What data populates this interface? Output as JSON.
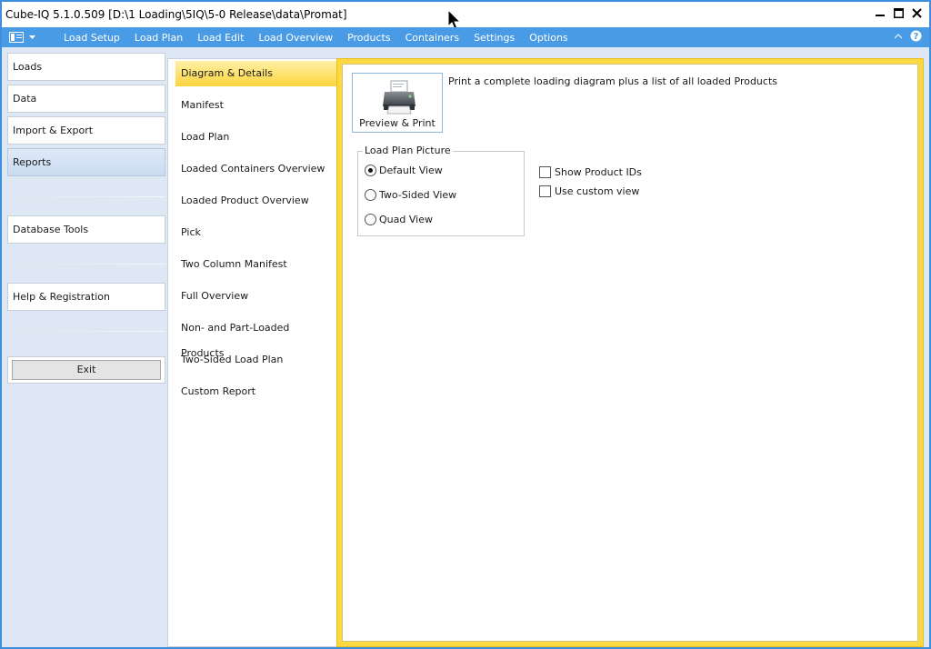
{
  "window": {
    "title": "Cube-IQ  5.1.0.509  [D:\\1 Loading\\5IQ\\5-0  Release\\data\\Promat]"
  },
  "menubar": {
    "items": [
      "Load Setup",
      "Load Plan",
      "Load Edit",
      "Load Overview",
      "Products",
      "Containers",
      "Settings",
      "Options"
    ]
  },
  "leftnav": {
    "loads": "Loads",
    "data": "Data",
    "import_export": "Import & Export",
    "reports": "Reports",
    "database_tools": "Database Tools",
    "help": "Help & Registration",
    "exit": "Exit"
  },
  "reports": {
    "items": [
      "Diagram & Details",
      "Manifest",
      "Load Plan",
      "Loaded Containers Overview",
      "Loaded Product Overview",
      "Pick",
      "Two Column Manifest",
      "Full Overview",
      "Non- and Part-Loaded Products",
      "Two-Sided Load Plan",
      "Custom Report"
    ]
  },
  "content": {
    "print_button": "Preview & Print",
    "description": "Print a complete loading diagram plus a list of all loaded Products",
    "group_title": "Load Plan Picture",
    "radio_options": [
      "Default View",
      "Two-Sided View",
      "Quad View"
    ],
    "checkboxes": [
      "Show Product IDs",
      "Use custom view"
    ]
  },
  "colors": {
    "accent_blue": "#4a9be6",
    "highlight_yellow": "#fcd843"
  }
}
